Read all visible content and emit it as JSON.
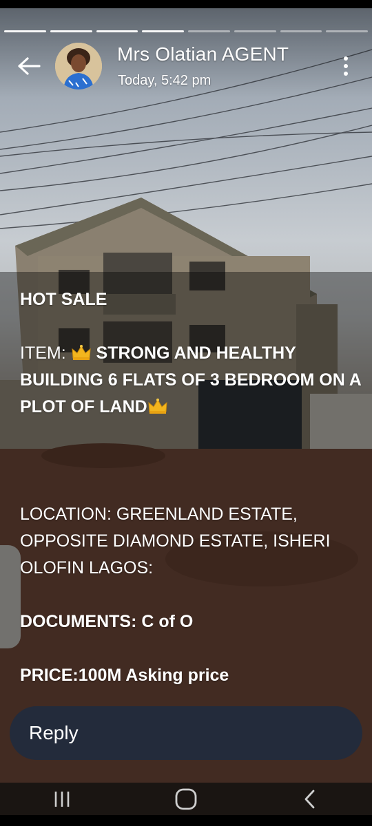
{
  "story": {
    "progress_segments": 8,
    "progress_done": 4
  },
  "header": {
    "name": "Mrs Olatian AGENT",
    "time": "Today, 5:42 pm",
    "back_icon": "arrow-left-icon",
    "menu_icon": "more-vertical-icon"
  },
  "caption": {
    "line1": "HOT SALE",
    "item_prefix": "ITEM: ",
    "item_text": " STRONG AND HEALTHY BUILDING  6 FLATS OF 3 BEDROOM ON A PLOT OF LAND",
    "location": "LOCATION: GREENLAND ESTATE, OPPOSITE DIAMOND ESTATE, ISHERI OLOFIN LAGOS:",
    "documents": "DOCUMENTS: C of O",
    "price": "PRICE:100M Asking price"
  },
  "reply": {
    "label": "Reply"
  },
  "navbar": {
    "recents_icon": "recents-icon",
    "home_icon": "home-icon",
    "back_icon": "nav-back-icon"
  }
}
